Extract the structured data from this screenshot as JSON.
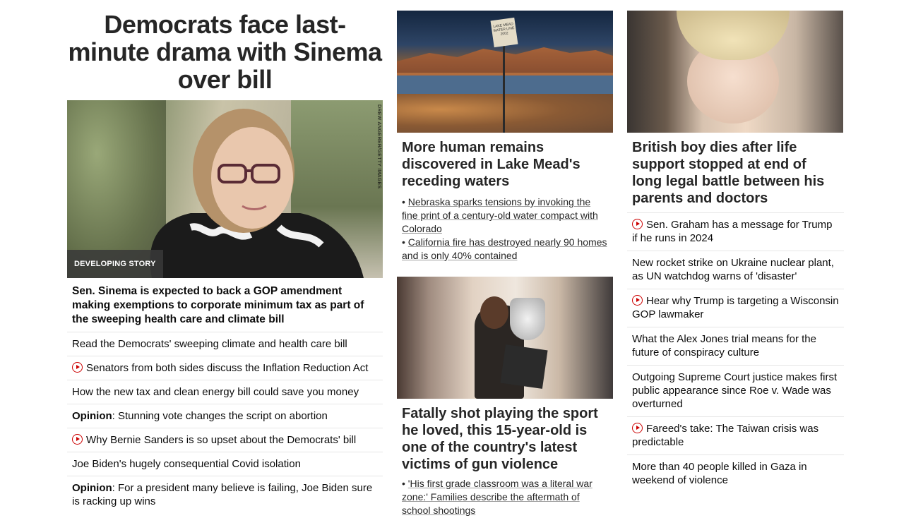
{
  "left": {
    "headline": "Democrats face last-minute drama with Sinema over bill",
    "photo_credit": "DREW ANGERER/GETTY IMAGES",
    "badge": "DEVELOPING STORY",
    "lead": "Sen. Sinema is expected to back a GOP amendment making exemptions to corporate minimum tax as part of the sweeping health care and climate bill",
    "items": [
      {
        "text": "Read the Democrats' sweeping climate and health care bill"
      },
      {
        "text": "Senators from both sides discuss the Inflation Reduction Act",
        "video": true
      },
      {
        "text": "How the new tax and clean energy bill could save you money"
      },
      {
        "label": "Opinion",
        "text": ": Stunning vote changes the script on abortion"
      },
      {
        "text": "Why Bernie Sanders is so upset about the Democrats' bill",
        "video": true
      },
      {
        "text": "Joe Biden's hugely consequential Covid isolation"
      },
      {
        "label": "Opinion",
        "text": ": For a president many believe is failing, Joe Biden sure is racking up wins"
      }
    ]
  },
  "middle": {
    "card1": {
      "sign_text": "LAKE MEAD WATER LINE 2002",
      "headline": "More human remains discovered in Lake Mead's receding waters",
      "sublinks": [
        "Nebraska sparks tensions by invoking the fine print of a century-old water compact with Colorado",
        "California fire has destroyed nearly 90 homes and is only 40% contained"
      ]
    },
    "card2": {
      "headline": "Fatally shot playing the sport he loved, this 15-year-old is one of the country's latest victims of gun violence",
      "sublinks": [
        "'His first grade classroom was a literal war zone:' Families describe the aftermath of school shootings"
      ]
    }
  },
  "right": {
    "headline": "British boy dies after life support stopped at end of long legal battle between his parents and doctors",
    "items": [
      {
        "text": "Sen. Graham has a message for Trump if he runs in 2024",
        "video": true
      },
      {
        "text": "New rocket strike on Ukraine nuclear plant, as UN watchdog warns of 'disaster'"
      },
      {
        "text": "Hear why Trump is targeting a Wisconsin GOP lawmaker",
        "video": true
      },
      {
        "text": "What the Alex Jones trial means for the future of conspiracy culture"
      },
      {
        "text": "Outgoing Supreme Court justice makes first public appearance since Roe v. Wade was overturned"
      },
      {
        "text": "Fareed's take: The Taiwan crisis was predictable",
        "video": true
      },
      {
        "text": "More than 40 people killed in Gaza in weekend of violence"
      }
    ]
  },
  "colors": {
    "video_icon": "#cc0000",
    "divider": "#e6e6e6",
    "badge_bg": "#383838"
  }
}
